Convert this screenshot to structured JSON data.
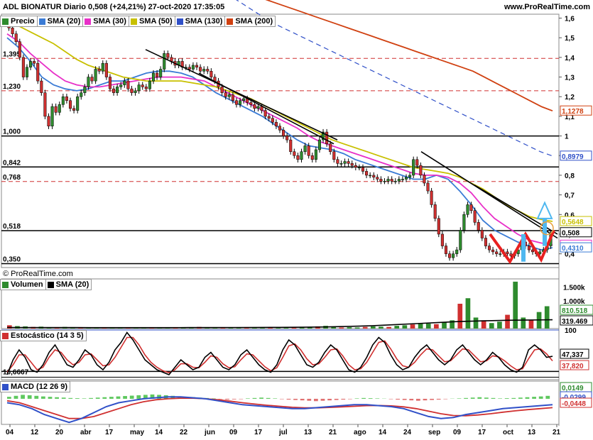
{
  "header": {
    "title": "ADL BIONATUR Diario 0,508 (+24,21%) 27-oct-2020 17:35:05",
    "url": "www.ProRealTime.com"
  },
  "watermark": "© ProRealTime.com",
  "legends": {
    "price": [
      {
        "label": "Precio",
        "color": "#2e8b2e"
      },
      {
        "label": "SMA (20)",
        "color": "#3a7bd5"
      },
      {
        "label": "SMA (30)",
        "color": "#e830c8"
      },
      {
        "label": "SMA (50)",
        "color": "#c8c000"
      },
      {
        "label": "SMA (130)",
        "color": "#3050c8"
      },
      {
        "label": "SMA (200)",
        "color": "#d04010"
      }
    ],
    "volume": [
      {
        "label": "Volumen",
        "color": "#2e8b2e"
      },
      {
        "label": "SMA (20)",
        "color": "#000000"
      }
    ],
    "stoch": [
      {
        "label": "Estocástico (14 3 5)",
        "color": "#d03030"
      }
    ],
    "macd": [
      {
        "label": "MACD (12 26 9)",
        "color": "#3050c8"
      }
    ]
  },
  "chart_data": [
    {
      "type": "candlestick",
      "panel": "price",
      "ylim": [
        0.33,
        1.62
      ],
      "y_ticks": [
        "1,6",
        "1,5",
        "1,4",
        "1,3",
        "1,2",
        "1,1",
        "1",
        "0,9",
        "0,8",
        "0,7",
        "0,6",
        "0,5",
        "0,4"
      ],
      "y_tick_values": [
        1.6,
        1.5,
        1.4,
        1.3,
        1.2,
        1.1,
        1.0,
        0.9,
        0.8,
        0.7,
        0.6,
        0.5,
        0.4
      ],
      "x_ticks": [
        "04",
        "12",
        "20",
        "abr",
        "17",
        "may",
        "14",
        "22",
        "jun",
        "09",
        "17",
        "jul",
        "13",
        "21",
        "ago",
        "14",
        "24",
        "sep",
        "09",
        "17",
        "oct",
        "13",
        "21"
      ],
      "levels": [
        {
          "value": 1.395,
          "label": "1,395",
          "style": "dashed-red"
        },
        {
          "value": 1.23,
          "label": "1,230",
          "style": "dashed-red"
        },
        {
          "value": 1.0,
          "label": "1,000",
          "style": "solid-black"
        },
        {
          "value": 0.842,
          "label": "0,842",
          "style": "solid-black"
        },
        {
          "value": 0.768,
          "label": "0,768",
          "style": "dashed-red"
        },
        {
          "value": 0.518,
          "label": "0,518",
          "style": "solid-black"
        },
        {
          "value": 0.35,
          "label": "0,350",
          "style": "solid-black"
        }
      ],
      "last_values": [
        {
          "label": "1,1278",
          "value": 1.1278,
          "color": "#d04010"
        },
        {
          "label": "0,8979",
          "value": 0.8979,
          "color": "#3050c8"
        },
        {
          "label": "0,5648",
          "value": 0.5648,
          "color": "#c8c000"
        },
        {
          "label": "0,508",
          "value": 0.508,
          "color": "#000000"
        },
        {
          "label": "0,4444",
          "value": 0.4444,
          "color": "#e830c8"
        },
        {
          "label": "0,4310",
          "value": 0.431,
          "color": "#3a7bd5"
        }
      ],
      "close": [
        1.55,
        1.52,
        1.48,
        1.4,
        1.3,
        1.35,
        1.38,
        1.37,
        1.28,
        1.22,
        1.1,
        1.05,
        1.15,
        1.12,
        1.16,
        1.2,
        1.18,
        1.14,
        1.13,
        1.2,
        1.22,
        1.25,
        1.3,
        1.28,
        1.34,
        1.33,
        1.37,
        1.3,
        1.24,
        1.22,
        1.25,
        1.26,
        1.28,
        1.24,
        1.22,
        1.23,
        1.26,
        1.25,
        1.24,
        1.28,
        1.32,
        1.3,
        1.34,
        1.42,
        1.4,
        1.38,
        1.36,
        1.38,
        1.35,
        1.35,
        1.34,
        1.36,
        1.35,
        1.33,
        1.34,
        1.33,
        1.3,
        1.28,
        1.25,
        1.22,
        1.2,
        1.21,
        1.18,
        1.16,
        1.18,
        1.19,
        1.17,
        1.16,
        1.14,
        1.15,
        1.13,
        1.1,
        1.09,
        1.07,
        1.05,
        1.03,
        1.0,
        0.98,
        0.92,
        0.9,
        0.88,
        0.92,
        0.95,
        0.9,
        0.88,
        0.93,
        0.98,
        1.02,
        0.96,
        0.92,
        0.88,
        0.86,
        0.86,
        0.87,
        0.86,
        0.85,
        0.84,
        0.84,
        0.82,
        0.8,
        0.8,
        0.79,
        0.78,
        0.77,
        0.77,
        0.78,
        0.77,
        0.77,
        0.78,
        0.78,
        0.79,
        0.8,
        0.88,
        0.85,
        0.8,
        0.76,
        0.72,
        0.65,
        0.58,
        0.5,
        0.44,
        0.4,
        0.38,
        0.4,
        0.42,
        0.52,
        0.6,
        0.65,
        0.62,
        0.56,
        0.52,
        0.48,
        0.44,
        0.42,
        0.41,
        0.4,
        0.4,
        0.41,
        0.4,
        0.39,
        0.4,
        0.42,
        0.46,
        0.44,
        0.42,
        0.41,
        0.4,
        0.41,
        0.42,
        0.44,
        0.508
      ],
      "series": [
        {
          "name": "SMA (20)",
          "color": "#3a7bd5",
          "values": [
            1.5,
            1.45,
            1.38,
            1.3,
            1.26,
            1.24,
            1.23,
            1.24,
            1.26,
            1.28,
            1.28,
            1.3,
            1.32,
            1.33,
            1.33,
            1.32,
            1.3,
            1.26,
            1.22,
            1.19,
            1.16,
            1.13,
            1.1,
            1.06,
            1.02,
            0.98,
            0.95,
            0.94,
            0.93,
            0.91,
            0.88,
            0.86,
            0.84,
            0.82,
            0.8,
            0.78,
            0.78,
            0.8,
            0.78,
            0.72,
            0.65,
            0.57,
            0.52,
            0.49,
            0.46,
            0.44,
            0.42,
            0.431
          ]
        },
        {
          "name": "SMA (30)",
          "color": "#e830c8",
          "values": [
            1.52,
            1.48,
            1.42,
            1.37,
            1.32,
            1.28,
            1.26,
            1.25,
            1.25,
            1.26,
            1.27,
            1.28,
            1.29,
            1.3,
            1.3,
            1.3,
            1.29,
            1.28,
            1.25,
            1.22,
            1.19,
            1.16,
            1.13,
            1.1,
            1.07,
            1.04,
            1.0,
            0.97,
            0.95,
            0.93,
            0.91,
            0.89,
            0.87,
            0.85,
            0.83,
            0.81,
            0.8,
            0.8,
            0.79,
            0.76,
            0.71,
            0.64,
            0.58,
            0.54,
            0.5,
            0.47,
            0.455,
            0.4444
          ]
        },
        {
          "name": "SMA (50)",
          "color": "#c8c000",
          "values": [
            1.58,
            1.56,
            1.53,
            1.5,
            1.47,
            1.43,
            1.39,
            1.36,
            1.34,
            1.32,
            1.3,
            1.29,
            1.28,
            1.28,
            1.28,
            1.28,
            1.27,
            1.26,
            1.25,
            1.23,
            1.21,
            1.19,
            1.16,
            1.13,
            1.1,
            1.07,
            1.04,
            1.01,
            0.98,
            0.96,
            0.94,
            0.92,
            0.9,
            0.88,
            0.86,
            0.84,
            0.83,
            0.82,
            0.81,
            0.79,
            0.76,
            0.73,
            0.69,
            0.65,
            0.62,
            0.59,
            0.575,
            0.5648
          ]
        },
        {
          "name": "SMA (130)",
          "color": "#3050c8",
          "dashed": true,
          "values": [
            1.7,
            1.66,
            1.62,
            1.58,
            1.55,
            1.52,
            1.49,
            1.46,
            1.43,
            1.4,
            1.37,
            1.34,
            1.31,
            1.28,
            1.25,
            1.22,
            1.19,
            1.16,
            1.13,
            1.1,
            1.07,
            1.04,
            1.01,
            0.98,
            0.95,
            0.92,
            0.8979
          ]
        },
        {
          "name": "SMA (200)",
          "color": "#d04010",
          "values": [
            1.75,
            1.73,
            1.71,
            1.69,
            1.67,
            1.65,
            1.63,
            1.61,
            1.59,
            1.57,
            1.55,
            1.53,
            1.51,
            1.49,
            1.47,
            1.45,
            1.43,
            1.41,
            1.39,
            1.37,
            1.35,
            1.33,
            1.3,
            1.27,
            1.24,
            1.21,
            1.18,
            1.15,
            1.1278
          ]
        }
      ]
    },
    {
      "type": "bar",
      "panel": "volume",
      "y_ticks": [
        "1.500k",
        "1.000k"
      ],
      "last_values": [
        {
          "label": "810.518",
          "color": "#2e8b2e"
        },
        {
          "label": "319.469",
          "color": "#000000"
        }
      ],
      "values": [
        120,
        90,
        80,
        60,
        70,
        50,
        40,
        60,
        50,
        40,
        30,
        40,
        30,
        50,
        40,
        30,
        20,
        30,
        40,
        30,
        20,
        30,
        40,
        50,
        60,
        40,
        30,
        40,
        50,
        40,
        30,
        30,
        40,
        30,
        40,
        30,
        30,
        40,
        60,
        80,
        100,
        60,
        40,
        50,
        40,
        60,
        80,
        70,
        60,
        100,
        120,
        150,
        200,
        180,
        160,
        220,
        300,
        900,
        1100,
        400,
        300,
        200,
        250,
        500,
        1700,
        400,
        300,
        600,
        810
      ],
      "sma": [
        40,
        38,
        36,
        35,
        34,
        33,
        33,
        34,
        35,
        36,
        38,
        40,
        45,
        50,
        60,
        80,
        100,
        140,
        180,
        220,
        260,
        280,
        300,
        310,
        319
      ]
    },
    {
      "type": "line",
      "panel": "stochastic",
      "y_ticks": [
        "100"
      ],
      "levels": [
        {
          "value": 16.667,
          "label": "16,6667"
        }
      ],
      "last_values": [
        {
          "label": "47,337",
          "color": "#000000"
        },
        {
          "label": "37,820",
          "color": "#d03030"
        }
      ],
      "series": [
        {
          "name": "K",
          "color": "#000000",
          "values": [
            10,
            40,
            60,
            45,
            20,
            15,
            30,
            55,
            70,
            50,
            30,
            25,
            40,
            60,
            50,
            30,
            20,
            35,
            60,
            75,
            95,
            80,
            60,
            40,
            30,
            20,
            15,
            10,
            25,
            40,
            30,
            20,
            25,
            45,
            55,
            40,
            25,
            20,
            30,
            50,
            60,
            45,
            30,
            20,
            15,
            30,
            60,
            80,
            70,
            50,
            30,
            25,
            35,
            55,
            70,
            60,
            40,
            20,
            15,
            25,
            45,
            70,
            85,
            75,
            50,
            30,
            20,
            25,
            45,
            60,
            70,
            55,
            40,
            30,
            40,
            60,
            70,
            55,
            40,
            30,
            40,
            55,
            45,
            30,
            20,
            15,
            25,
            60,
            70,
            60,
            45,
            47
          ]
        },
        {
          "name": "D",
          "color": "#d03030",
          "values": [
            15,
            30,
            50,
            50,
            35,
            20,
            25,
            45,
            60,
            55,
            40,
            30,
            35,
            50,
            52,
            40,
            28,
            30,
            45,
            65,
            85,
            85,
            70,
            50,
            35,
            25,
            18,
            14,
            20,
            32,
            32,
            25,
            24,
            35,
            48,
            45,
            32,
            24,
            26,
            40,
            52,
            50,
            38,
            26,
            18,
            24,
            45,
            68,
            72,
            60,
            42,
            30,
            32,
            45,
            60,
            62,
            48,
            30,
            20,
            22,
            35,
            55,
            75,
            78,
            62,
            42,
            28,
            25,
            35,
            50,
            62,
            60,
            48,
            36,
            38,
            50,
            62,
            60,
            48,
            36,
            38,
            48,
            46,
            38,
            28,
            20,
            22,
            42,
            60,
            62,
            52,
            37.8
          ]
        }
      ]
    },
    {
      "type": "bar",
      "panel": "macd",
      "last_values": [
        {
          "label": "0,0149",
          "color": "#2e8b2e"
        },
        {
          "label": "-0,0299",
          "color": "#3050c8"
        },
        {
          "label": "-0,0448",
          "color": "#d03030"
        }
      ],
      "histogram": [
        0.01,
        0.015,
        0.02,
        0.018,
        0.015,
        0.012,
        0.01,
        0.008,
        0.006,
        0.004,
        0.003,
        0.002,
        0.004,
        0.006,
        0.008,
        0.01,
        0.012,
        0.014,
        0.016,
        0.018,
        0.02,
        0.022,
        0.02,
        0.018,
        0.015,
        0.012,
        0.01,
        0.008,
        0.006,
        0.004,
        0.002,
        -0.002,
        -0.004,
        -0.003,
        -0.002,
        0.002,
        0.004,
        0.006,
        0.004,
        0.002,
        -0.002,
        -0.004,
        -0.006,
        -0.008,
        -0.01,
        -0.012,
        -0.01,
        -0.008,
        -0.006,
        -0.004,
        -0.002,
        0.002,
        0.004,
        0.003,
        0.002,
        0.001,
        -0.002,
        -0.004,
        -0.006,
        -0.008,
        -0.01,
        -0.008,
        -0.006,
        -0.004,
        -0.002,
        0.001,
        0.002,
        0.004,
        0.006,
        0.008,
        0.006,
        0.004,
        0.002,
        0.003,
        0.004,
        0.006,
        0.008,
        0.01,
        0.012,
        0.0149
      ],
      "series": [
        {
          "name": "MACD",
          "color": "#3050c8",
          "values": [
            -0.02,
            -0.03,
            -0.05,
            -0.08,
            -0.1,
            -0.12,
            -0.1,
            -0.07,
            -0.04,
            -0.02,
            -0.01,
            0.0,
            0.005,
            0.01,
            0.01,
            0.005,
            0.0,
            -0.01,
            -0.02,
            -0.03,
            -0.035,
            -0.04,
            -0.045,
            -0.05,
            -0.05,
            -0.045,
            -0.04,
            -0.035,
            -0.03,
            -0.03,
            -0.035,
            -0.04,
            -0.05,
            -0.07,
            -0.09,
            -0.1,
            -0.095,
            -0.08,
            -0.07,
            -0.06,
            -0.05,
            -0.045,
            -0.04,
            -0.035,
            -0.03
          ]
        },
        {
          "name": "Signal",
          "color": "#d03030",
          "values": [
            -0.01,
            -0.02,
            -0.04,
            -0.06,
            -0.08,
            -0.1,
            -0.1,
            -0.09,
            -0.07,
            -0.05,
            -0.03,
            -0.015,
            -0.005,
            0.0,
            0.003,
            0.003,
            0.0,
            -0.005,
            -0.012,
            -0.02,
            -0.027,
            -0.033,
            -0.038,
            -0.043,
            -0.046,
            -0.046,
            -0.044,
            -0.041,
            -0.038,
            -0.035,
            -0.034,
            -0.036,
            -0.041,
            -0.05,
            -0.063,
            -0.076,
            -0.085,
            -0.086,
            -0.082,
            -0.076,
            -0.068,
            -0.061,
            -0.055,
            -0.05,
            -0.0448
          ]
        }
      ]
    }
  ]
}
